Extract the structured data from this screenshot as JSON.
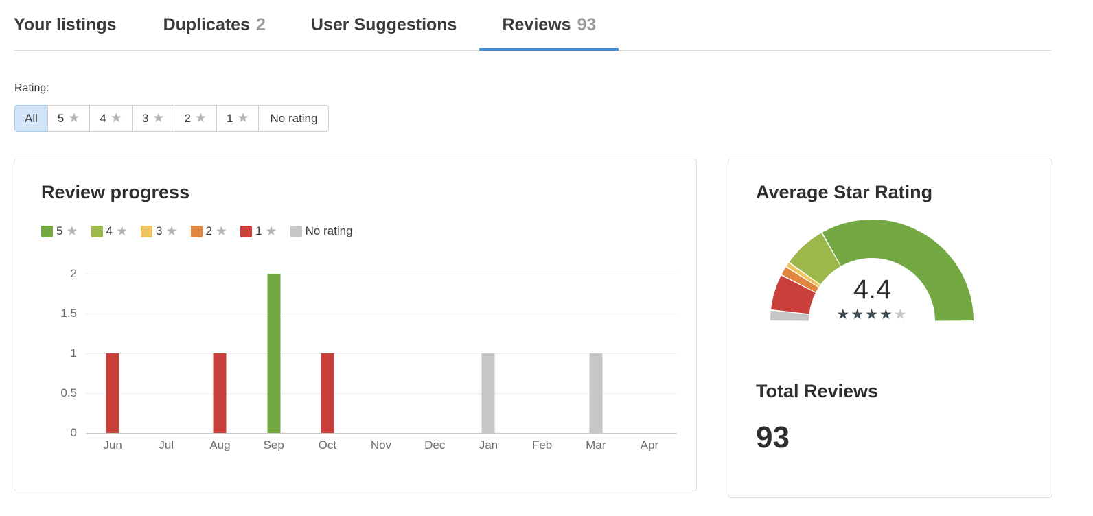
{
  "theme": {
    "accent": "#4a8fd4",
    "card_border": "#dddddd",
    "text": "#333333",
    "muted": "#6d6d6d"
  },
  "tabs": [
    {
      "label": "Your listings",
      "count": "",
      "active": false
    },
    {
      "label": "Duplicates",
      "count": "2",
      "active": false
    },
    {
      "label": "User Suggestions",
      "count": "",
      "active": false
    },
    {
      "label": "Reviews",
      "count": "93",
      "active": true
    }
  ],
  "filter": {
    "label": "Rating:",
    "star_icon": "★",
    "options": [
      {
        "value": "All",
        "star": false,
        "selected": true
      },
      {
        "value": "5",
        "star": true,
        "selected": false
      },
      {
        "value": "4",
        "star": true,
        "selected": false
      },
      {
        "value": "3",
        "star": true,
        "selected": false
      },
      {
        "value": "2",
        "star": true,
        "selected": false
      },
      {
        "value": "1",
        "star": true,
        "selected": false
      },
      {
        "value": "No rating",
        "star": false,
        "selected": false
      }
    ]
  },
  "progress_card": {
    "title": "Review progress",
    "legend": [
      {
        "label": "5",
        "star": true,
        "color": "#74a843"
      },
      {
        "label": "4",
        "star": true,
        "color": "#9cb74a"
      },
      {
        "label": "3",
        "star": true,
        "color": "#eec461"
      },
      {
        "label": "2",
        "star": true,
        "color": "#e08641"
      },
      {
        "label": "1",
        "star": true,
        "color": "#c9403a"
      },
      {
        "label": "No rating",
        "star": false,
        "color": "#c6c6c6"
      }
    ]
  },
  "rating_card": {
    "average_title": "Average Star Rating",
    "average_value": "4.4",
    "stars_filled": 4,
    "stars_total": 5,
    "star_glyph": "★",
    "total_title": "Total Reviews",
    "total_value": "93"
  },
  "chart_data": {
    "type": "bar",
    "title": "Review progress",
    "xlabel": "",
    "ylabel": "",
    "ylim": [
      0,
      2
    ],
    "yticks": [
      "0",
      "0.5",
      "1",
      "1.5",
      "2"
    ],
    "grid": true,
    "legend_position": "top-left",
    "categories": [
      "Jun",
      "Jul",
      "Aug",
      "Sep",
      "Oct",
      "Nov",
      "Dec",
      "Jan",
      "Feb",
      "Mar",
      "Apr"
    ],
    "series": [
      {
        "name": "5 ★",
        "color": "#74a843",
        "values": [
          0,
          0,
          0,
          2,
          0,
          0,
          0,
          0,
          0,
          0,
          0
        ]
      },
      {
        "name": "4 ★",
        "color": "#9cb74a",
        "values": [
          0,
          0,
          0,
          0,
          0,
          0,
          0,
          0,
          0,
          0,
          0
        ]
      },
      {
        "name": "3 ★",
        "color": "#eec461",
        "values": [
          0,
          0,
          0,
          0,
          0,
          0,
          0,
          0,
          0,
          0,
          0
        ]
      },
      {
        "name": "2 ★",
        "color": "#e08641",
        "values": [
          0,
          0,
          0,
          0,
          0,
          0,
          0,
          0,
          0,
          0,
          0
        ]
      },
      {
        "name": "1 ★",
        "color": "#c9403a",
        "values": [
          1,
          0,
          1,
          0,
          1,
          0,
          0,
          0,
          0,
          0,
          0
        ]
      },
      {
        "name": "No rating",
        "color": "#c6c6c6",
        "values": [
          0,
          0,
          0,
          0,
          0,
          0,
          0,
          1,
          0,
          1,
          0
        ]
      }
    ]
  },
  "gauge_data": {
    "type": "pie",
    "title": "Average Star Rating",
    "value": 4.4,
    "max": 5,
    "segments": [
      {
        "name": "No rating",
        "color": "#c6c6c6",
        "fraction": 0.035
      },
      {
        "name": "1 star",
        "color": "#c9403a",
        "fraction": 0.115
      },
      {
        "name": "2 stars",
        "color": "#e08641",
        "fraction": 0.03
      },
      {
        "name": "3 stars",
        "color": "#eec461",
        "fraction": 0.016
      },
      {
        "name": "4 stars",
        "color": "#9cb74a",
        "fraction": 0.14
      },
      {
        "name": "5 stars",
        "color": "#74a843",
        "fraction": 0.664
      }
    ]
  }
}
